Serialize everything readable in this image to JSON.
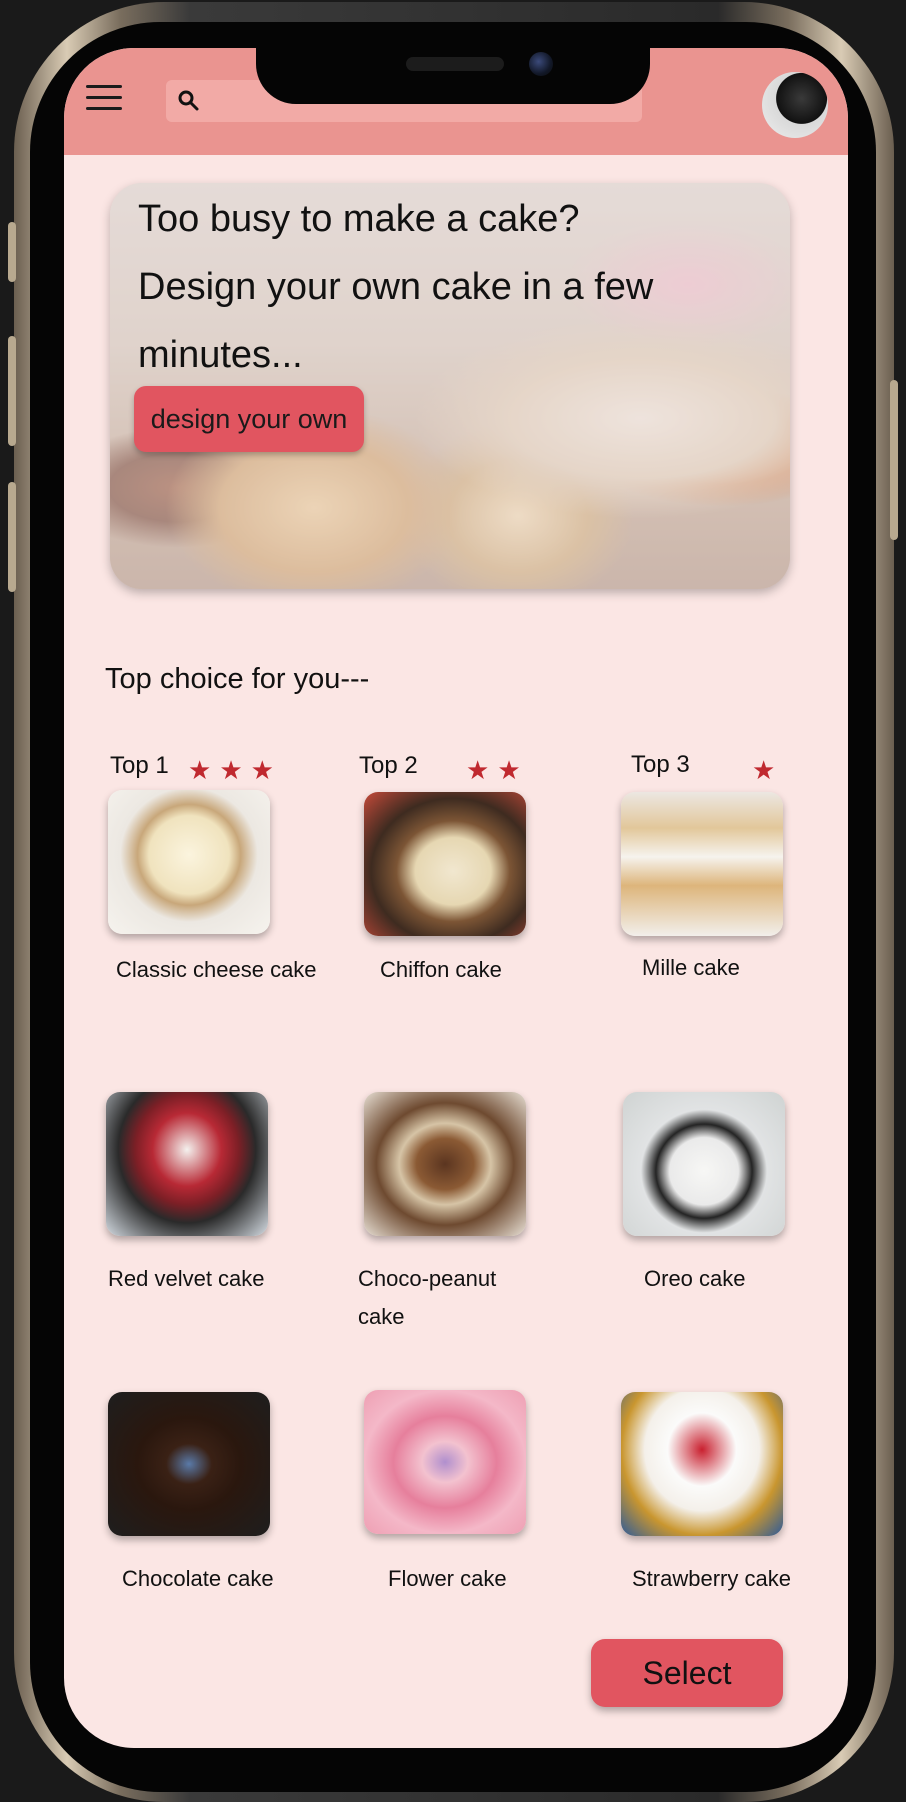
{
  "header": {
    "menu_icon": "hamburger-menu-icon",
    "search": {
      "placeholder": "",
      "icon": "search-icon"
    },
    "avatar_icon": "user-avatar"
  },
  "banner": {
    "headline_line1": "Too busy to make a  cake?",
    "headline_line2": "Design your own cake in a few",
    "headline_line3": "minutes...",
    "button_label": "design your own"
  },
  "section_title": "Top choice for you---",
  "top_picks": [
    {
      "rank": "Top 1",
      "stars": 3,
      "name": "Classic cheese cake"
    },
    {
      "rank": "Top 2",
      "stars": 2,
      "name": "Chiffon cake"
    },
    {
      "rank": "Top 3",
      "stars": 1,
      "name": "Mille cake"
    }
  ],
  "cakes": [
    {
      "name": "Red velvet cake"
    },
    {
      "name": "Choco-peanut cake"
    },
    {
      "name": "Oreo cake"
    },
    {
      "name": "Chocolate cake"
    },
    {
      "name": "Flower cake"
    },
    {
      "name": "Strawberry cake"
    }
  ],
  "colors": {
    "header": "#ea9490",
    "background": "#fbe6e4",
    "accent_button": "#e15560",
    "star": "#c0292f"
  },
  "select_button_label": "Select"
}
